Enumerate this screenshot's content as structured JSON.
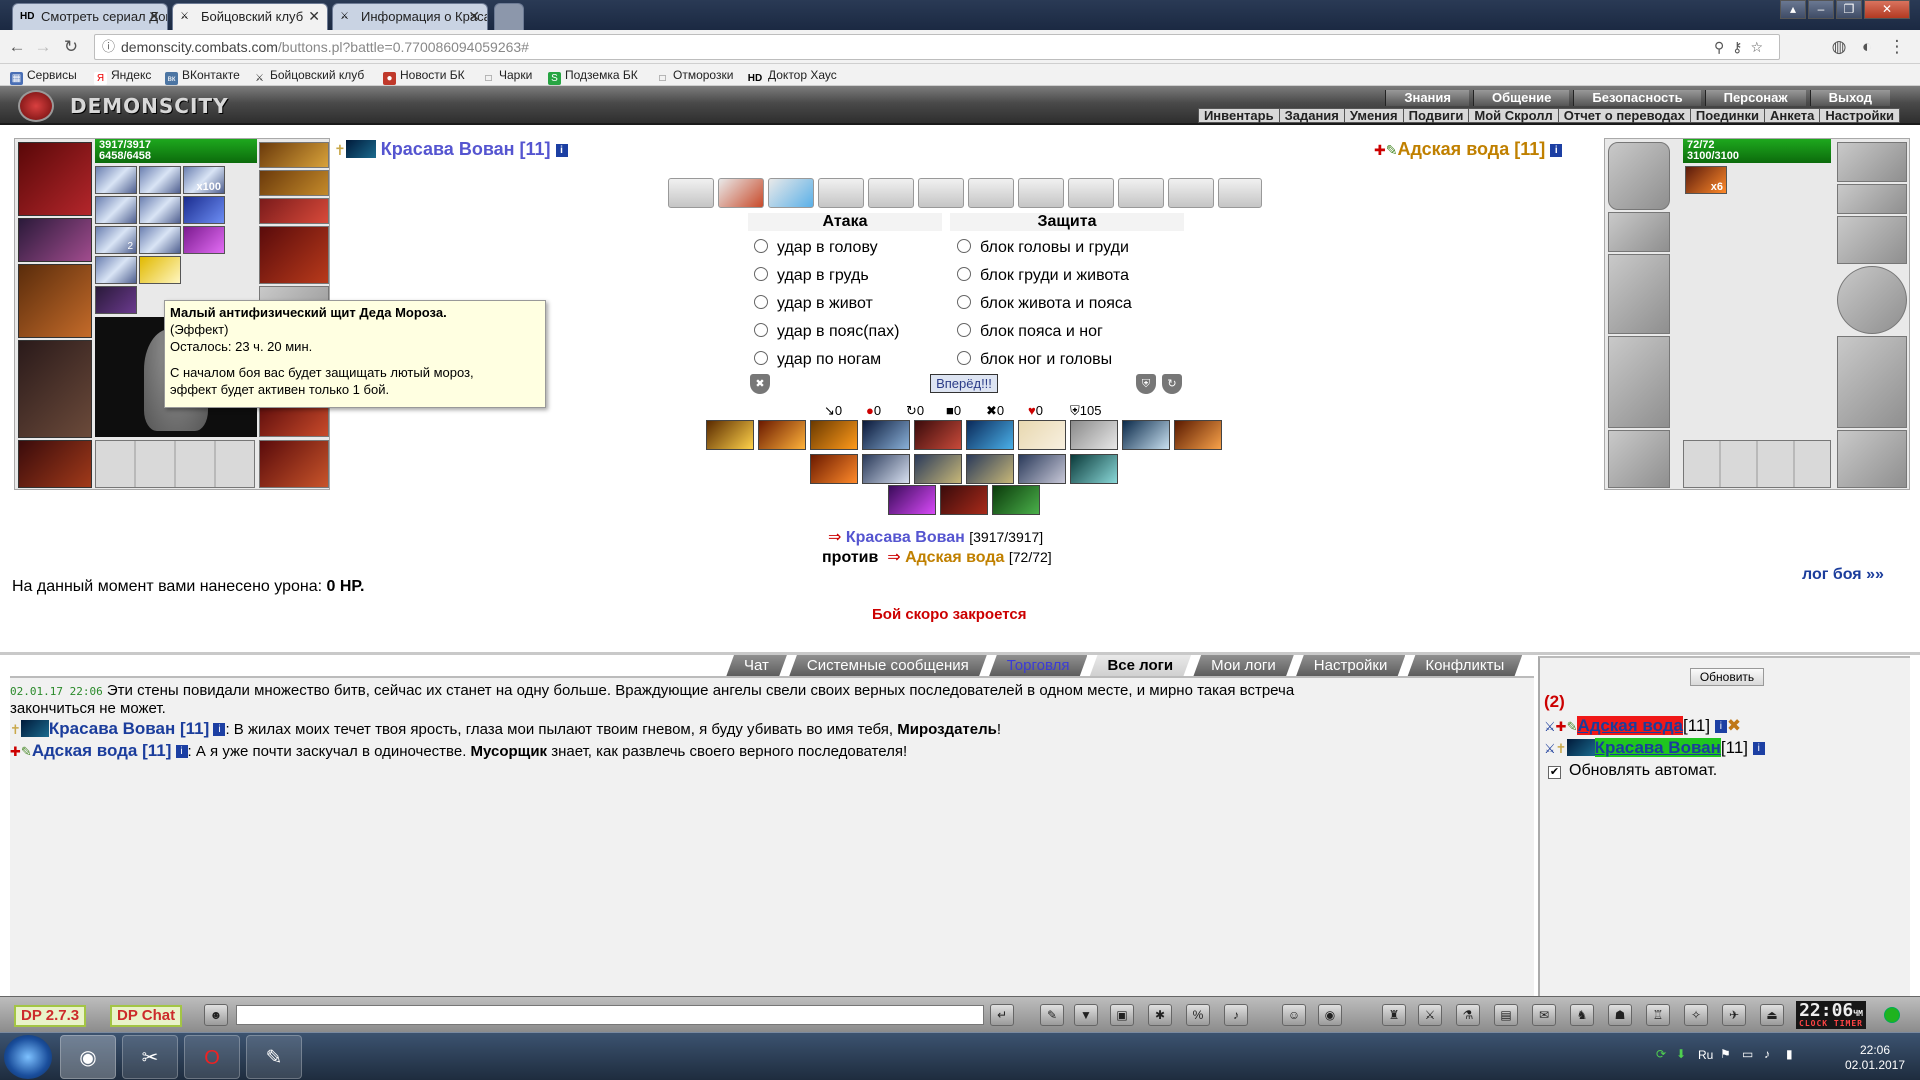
{
  "browser": {
    "tabs": [
      {
        "icon": "HD",
        "title": "Смотреть сериал Доктор"
      },
      {
        "icon": "⚔",
        "title": "Бойцовский клуб"
      },
      {
        "icon": "⚔",
        "title": "Информация о Красаве"
      }
    ],
    "url_host": "demonscity.combats.com",
    "url_path": "/buttons.pl?battle=0.770086094059263#",
    "bookmarks": [
      "Сервисы",
      "Яндекс",
      "ВКонтакте",
      "Бойцовский клуб",
      "Новости БК",
      "Чарки",
      "Подземка БК",
      "Отморозки",
      "Доктор Хаус"
    ],
    "bookmark_icons": [
      "▦",
      "Я",
      "вк",
      "⚔",
      "●",
      "□",
      "S",
      "□",
      "HD"
    ]
  },
  "header": {
    "logo_text": "DEMONSCITY",
    "top_menu": [
      "Знания",
      "Общение",
      "Безопасность",
      "Персонаж",
      "Выход"
    ],
    "sub_menu": [
      "Инвентарь",
      "Задания",
      "Умения",
      "Подвиги",
      "Мой Скролл",
      "Отчет о переводах",
      "Поединки",
      "Анкета",
      "Настройки"
    ]
  },
  "player": {
    "name": "Красава Вован [11]",
    "hp": "3917/3917",
    "mana": "6458/6458",
    "x100": "x100",
    "count2": "2"
  },
  "enemy": {
    "name": "Адская вода [11]",
    "hp": "72/72",
    "mana": "3100/3100",
    "x6": "x6"
  },
  "tooltip": {
    "title": "Малый антифизический щит Деда Мороза.",
    "type": "(Эффект)",
    "remaining": "Осталось: 23 ч. 20 мин.",
    "desc1": "С началом боя вас будет защищать лютый мороз,",
    "desc2": "эффект будет активен только 1 бой."
  },
  "battle": {
    "attack_header": "Атака",
    "defense_header": "Защита",
    "attacks": [
      "удар в голову",
      "удар в грудь",
      "удар в живот",
      "удар в пояс(пах)",
      "удар по ногам"
    ],
    "defenses": [
      "блок головы и груди",
      "блок груди и живота",
      "блок живота и пояса",
      "блок пояса и ног",
      "блок ног и головы"
    ],
    "go_button": "Вперёд!!!",
    "stats": [
      "0",
      "0",
      "0",
      "0",
      "0",
      "0",
      "105"
    ],
    "stat_icons": [
      "↘",
      "●",
      "↻",
      "■",
      "✖",
      "♥",
      "⛨"
    ],
    "vs_player": "Красава Вован",
    "vs_player_hp": "[3917/3917]",
    "vs_word": "против",
    "vs_enemy": "Адская вода",
    "vs_enemy_hp": "[72/72]",
    "damage_label": "На данный момент вами нанесено урона:",
    "damage_value": "0 HP.",
    "closing_soon": "Бой скоро закроется",
    "log_link": "лог боя »»"
  },
  "log_tabs": [
    "Чат",
    "Системные сообщения",
    "Торговля",
    "Все логи",
    "Мои логи",
    "Настройки",
    "Конфликты"
  ],
  "chat": {
    "timestamp": "02.01.17 22:06",
    "line1": "Эти стены повидали множество битв, сейчас их станет на одну больше. Враждующие ангелы свели своих верных последователей в одном месте, и мирно такая встреча",
    "line1b": "закончиться не может.",
    "line2_name": "Красава Вован [11]",
    "line2_text": ": В жилах моих течет твоя ярость, глаза мои пылают твоим гневом, я буду убивать во имя тебя,",
    "line2_bold": "Мироздатель",
    "line2_end": "!",
    "line3_name": "Адская вода [11]",
    "line3_text": ": А я уже почти заскучал в одиночестве.",
    "line3_bold": "Мусорщик",
    "line3_end": "знает, как развлечь своего верного последователя!"
  },
  "sidebar": {
    "refresh_button": "Обновить",
    "count": "(2)",
    "list": [
      {
        "name": "Адская вода",
        "level": "[11]"
      },
      {
        "name": "Красава Вован",
        "level": "[11]"
      }
    ],
    "auto_refresh": "Обновлять автомат."
  },
  "bottom": {
    "badge1": "DP 2.7.3",
    "badge2": "DP Chat",
    "clock": "22:06",
    "clock_sub": "ЧМ",
    "clock_label": "CLOCK TIMER"
  },
  "taskbar": {
    "lang": "Ru",
    "time": "22:06",
    "date": "02.01.2017"
  },
  "colors": {
    "player_name": "#5555d0",
    "enemy_name": "#c08000",
    "hp_green": "#1ea81e",
    "alert_red": "#cc0000",
    "link_blue": "#1b3d9c"
  }
}
